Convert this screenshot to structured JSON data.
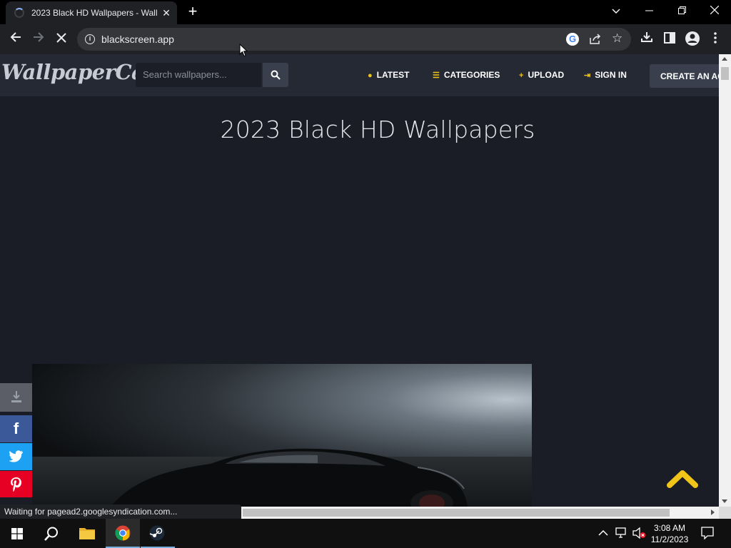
{
  "browser": {
    "tab_title": "2023 Black HD Wallpapers - Wall",
    "url": "blackscreen.app",
    "status_text": "Waiting for pagead2.googlesyndication.com..."
  },
  "site": {
    "logo_text": "WallpaperCave",
    "search_placeholder": "Search wallpapers...",
    "nav": {
      "latest": "LATEST",
      "categories": "CATEGORIES",
      "upload": "UPLOAD",
      "sign_in": "SIGN IN",
      "create_account": "CREATE AN AC"
    },
    "page_title": "2023 Black HD Wallpapers"
  },
  "share": {
    "facebook_glyph": "f",
    "download_icon": "download-icon",
    "twitter_icon": "twitter-icon",
    "pinterest_icon": "pinterest-icon"
  },
  "colors": {
    "accent_yellow": "#f0c419",
    "facebook": "#3b5998",
    "twitter": "#1da1f2",
    "pinterest": "#e60023"
  },
  "taskbar": {
    "time": "3:08 AM",
    "date": "11/2/2023"
  }
}
